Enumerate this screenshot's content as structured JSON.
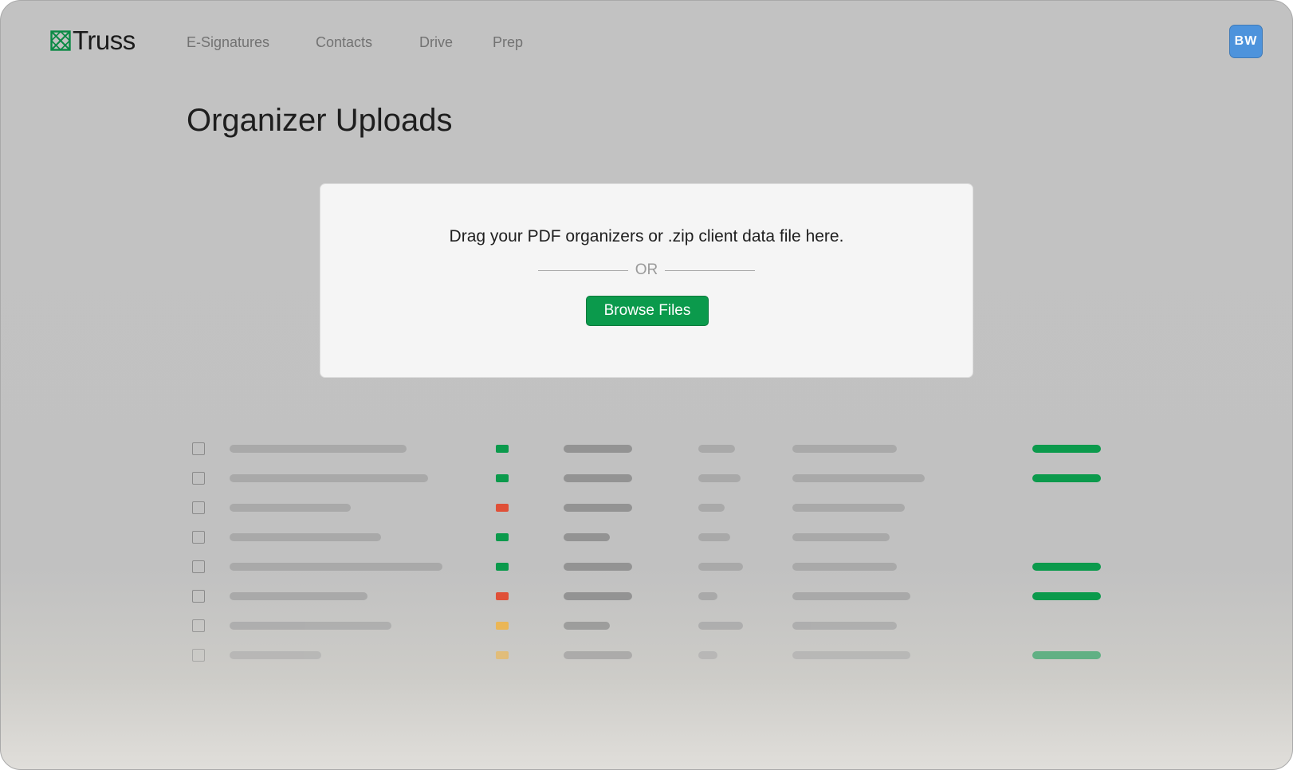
{
  "app": {
    "logo_text": "Truss",
    "brand_color": "#0b8a45"
  },
  "nav": {
    "items": [
      {
        "label": "E-Signatures",
        "id": "esignatures"
      },
      {
        "label": "Contacts",
        "id": "contacts"
      },
      {
        "label": "Drive",
        "id": "drive"
      },
      {
        "label": "Prep",
        "id": "prep"
      }
    ]
  },
  "user": {
    "initials": "BW",
    "avatar_color": "#4d93dc"
  },
  "page": {
    "title": "Organizer Uploads"
  },
  "dropzone": {
    "instruction": "Drag your PDF organizers or .zip client data file here.",
    "or_label": "OR",
    "browse_label": "Browse Files",
    "button_color": "#0b9a4c"
  },
  "table": {
    "placeholder": true,
    "row_status_colors": [
      "green",
      "green",
      "red",
      "green",
      "green",
      "red",
      "yellow",
      "yellow"
    ],
    "row_has_progress": [
      true,
      true,
      false,
      false,
      true,
      true,
      false,
      true
    ],
    "status_palette": {
      "green": "#0b9a4c",
      "red": "#e05038",
      "yellow": "#f4b23a"
    }
  }
}
